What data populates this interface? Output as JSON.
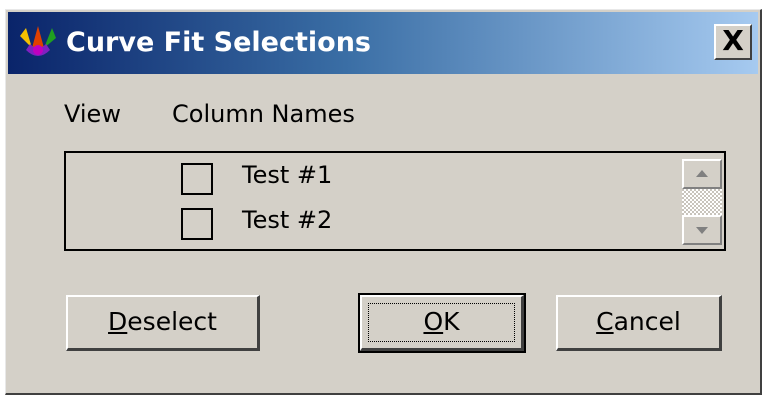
{
  "window": {
    "title": "Curve Fit Selections",
    "close_label": "X",
    "icon": "curve-fit-app-icon"
  },
  "headers": {
    "view": "View",
    "column_names": "Column Names"
  },
  "columns": [
    {
      "label": "Test #1",
      "checked": false
    },
    {
      "label": "Test #2",
      "checked": false
    }
  ],
  "buttons": {
    "deselect_mnemonic": "D",
    "deselect_rest": "eselect",
    "ok_mnemonic": "O",
    "ok_rest": "K",
    "cancel_mnemonic": "C",
    "cancel_rest": "ancel"
  },
  "colors": {
    "titlebar_start": "#0a246a",
    "titlebar_end": "#a6caf0",
    "dialog_bg": "#d4d0c8"
  }
}
